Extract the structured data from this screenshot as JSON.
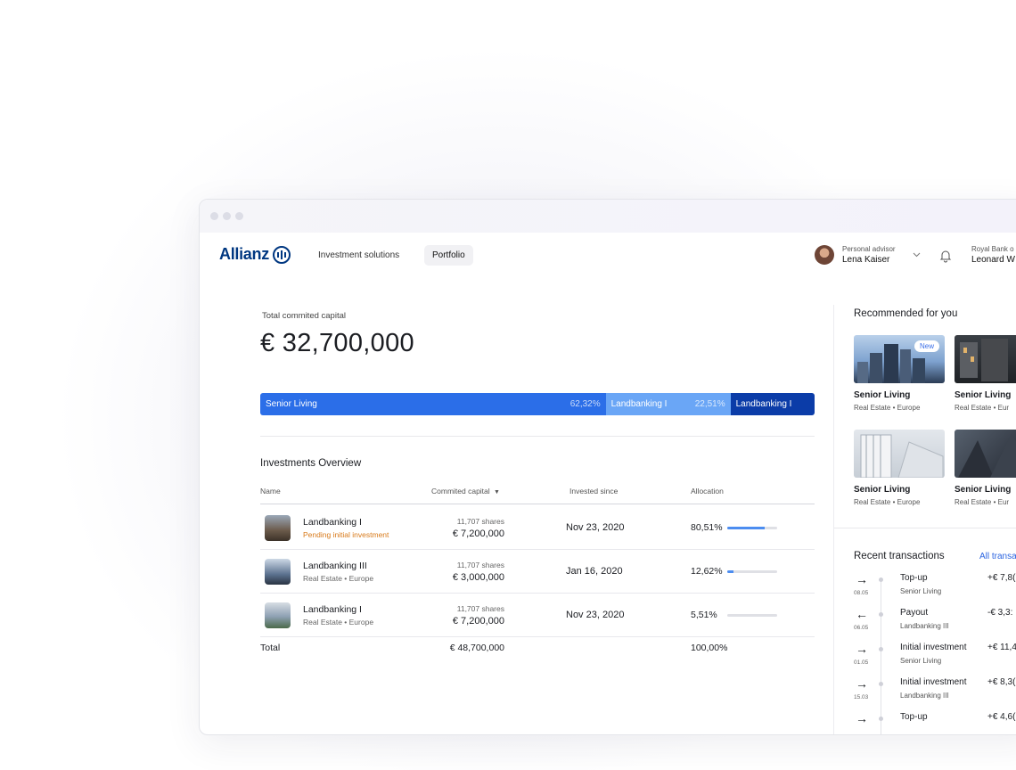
{
  "nav": {
    "brand": "Allianz",
    "links": [
      "Investment solutions",
      "Portfolio"
    ],
    "active": "Portfolio",
    "advisor_label": "Personal advisor",
    "advisor_name": "Lena Kaiser",
    "bank_label": "Royal Bank o",
    "bank_user": "Leonard W"
  },
  "summary": {
    "label": "Total commited capital",
    "value": "€ 32,700,000"
  },
  "allocation_bar": [
    {
      "name": "Senior Living",
      "pct": "62,32%",
      "share": 0.6232,
      "color": "#2b6ee8"
    },
    {
      "name": "Landbanking I",
      "pct": "22,51%",
      "share": 0.2251,
      "color": "#6aa6f6"
    },
    {
      "name": "Landbanking I",
      "pct": "",
      "share": 0.1517,
      "color": "#0b3ca8"
    }
  ],
  "overview": {
    "title": "Investments Overview",
    "columns": [
      "Name",
      "Commited capital",
      "Invested since",
      "Allocation"
    ],
    "rows": [
      {
        "name": "Landbanking I",
        "sub": "Pending initial investment",
        "pending": true,
        "shares": "11,707 shares",
        "amount": "€ 7,200,000",
        "since": "Nov 23, 2020",
        "pct": "80,51%",
        "level": 0.75
      },
      {
        "name": "Landbanking III",
        "sub": "Real Estate • Europe",
        "pending": false,
        "shares": "11,707 shares",
        "amount": "€ 3,000,000",
        "since": "Jan 16, 2020",
        "pct": "12,62%",
        "level": 0.13
      },
      {
        "name": "Landbanking I",
        "sub": "Real Estate • Europe",
        "pending": false,
        "shares": "11,707 shares",
        "amount": "€ 7,200,000",
        "since": "Nov 23, 2020",
        "pct": "5,51%",
        "level": 0.0
      }
    ],
    "total_label": "Total",
    "total_amount": "€ 48,700,000",
    "total_pct": "100,00%"
  },
  "recommended": {
    "title": "Recommended for you",
    "badge": "New",
    "cards": [
      {
        "name": "Senior Living",
        "sub": "Real Estate • Europe"
      },
      {
        "name": "Senior Living",
        "sub": "Real Estate • Eur"
      },
      {
        "name": "Senior Living",
        "sub": "Real Estate • Europe"
      },
      {
        "name": "Senior Living",
        "sub": "Real Estate • Eur"
      }
    ]
  },
  "transactions": {
    "title": "Recent transactions",
    "all_link": "All transa",
    "items": [
      {
        "arrow": "→",
        "date": "08.05",
        "name": "Top-up",
        "sub": "Senior Living",
        "amount": "+€ 7,8("
      },
      {
        "arrow": "←",
        "date": "06.05",
        "name": "Payout",
        "sub": "Landbanking III",
        "amount": "-€ 3,3:"
      },
      {
        "arrow": "→",
        "date": "01.05",
        "name": "Initial investment",
        "sub": "Senior Living",
        "amount": "+€ 11,4("
      },
      {
        "arrow": "→",
        "date": "15.03",
        "name": "Initial investment",
        "sub": "Landbanking III",
        "amount": "+€ 8,3("
      },
      {
        "arrow": "→",
        "date": "",
        "name": "Top-up",
        "sub": "",
        "amount": "+€ 4,6("
      }
    ]
  }
}
